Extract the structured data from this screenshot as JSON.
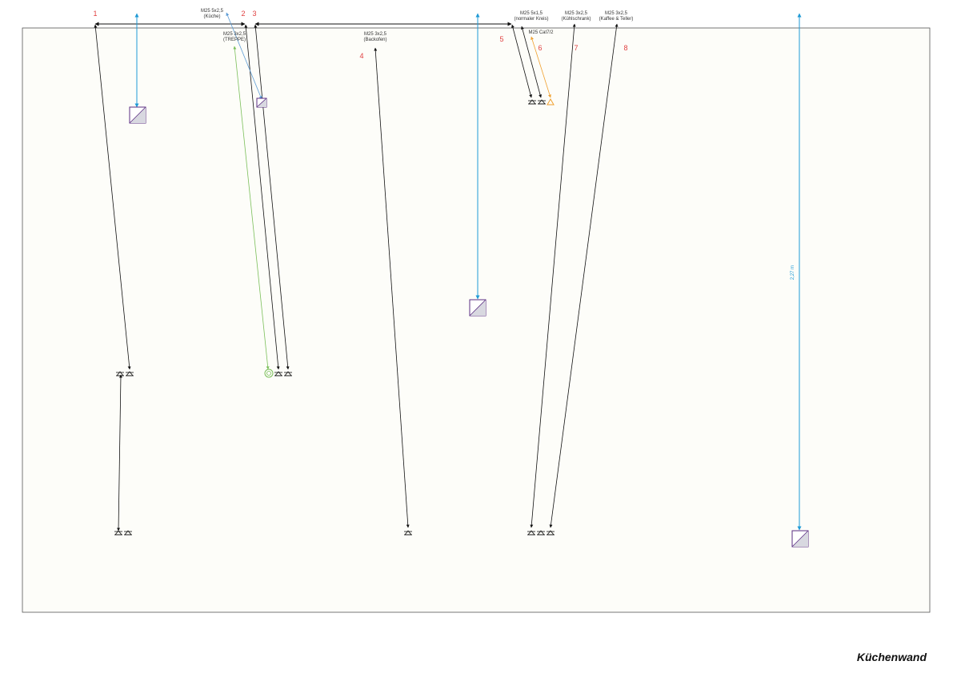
{
  "title": "Küchenwand",
  "colors": {
    "wire": "#111111",
    "dimension": "#1e9ad6",
    "label_blue": "#5b9bd5",
    "label_green": "#7bbf5a",
    "label_orange": "#f0a030",
    "number": "#e04040",
    "box_border": "#5a2d82",
    "box_fill": "#d8d8e0",
    "frame": "#555555",
    "background": "#fdfdf9"
  },
  "circuit_numbers": [
    "1",
    "2",
    "3",
    "4",
    "5",
    "6",
    "7",
    "8"
  ],
  "cable_labels": {
    "kueche": {
      "line1": "M25 5x2,5",
      "line2": "(Küche)"
    },
    "treppe": {
      "line1": "M25 3x2,5",
      "line2": "(TREPPE)"
    },
    "backofen": {
      "line1": "M25 3x2,5",
      "line2": "(Backofen)"
    },
    "normaler_kreis": {
      "line1": "M25 5x1,5",
      "line2": "(normaler Kreis)"
    },
    "cat": {
      "line1": "M25 Cat7/2"
    },
    "kuehlschrank": {
      "line1": "M25 3x2,5",
      "line2": "(Kühlschrank)"
    },
    "kaffee": {
      "line1": "M25 3x2,5",
      "line2": "(Kaffee & Teller)"
    }
  },
  "dimension_label": "2,27 m"
}
